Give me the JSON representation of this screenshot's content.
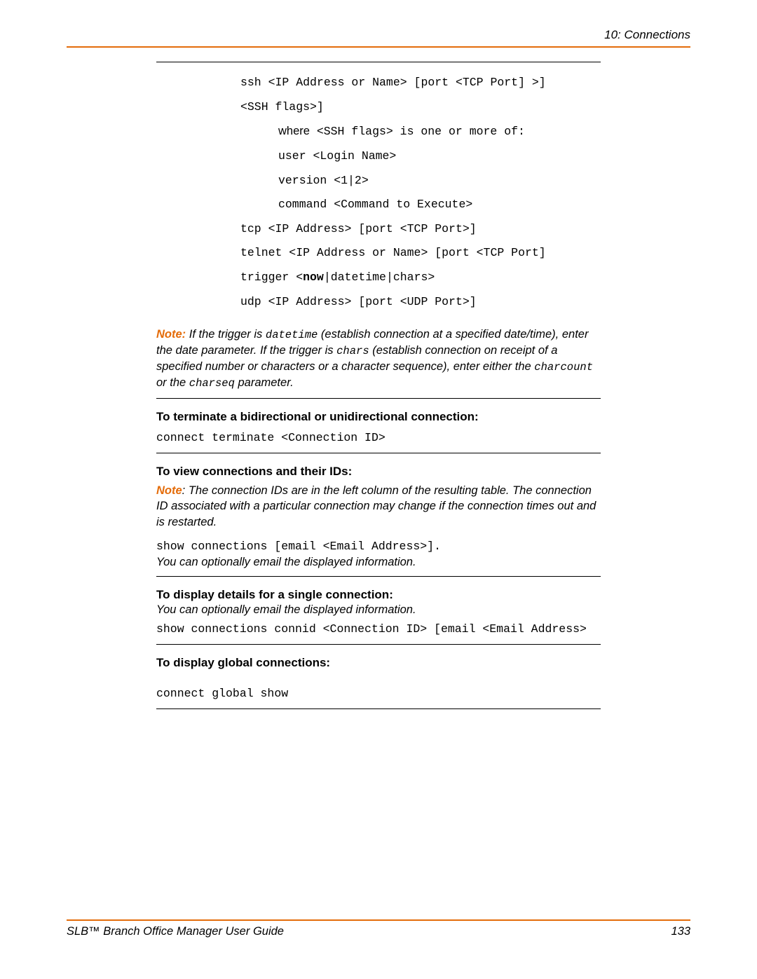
{
  "header": {
    "chapter": "10: Connections"
  },
  "codeblock": {
    "l1": "ssh <IP Address or Name> [port <TCP Port] >]",
    "l2": "<SSH flags>]",
    "l3_where": "where",
    "l3_rest": " <SSH flags> is one or more of:",
    "l4": "user <Login Name>",
    "l5": "version <1|2>",
    "l6": "command <Command to Execute>",
    "l7": "tcp <IP Address> [port <TCP Port>]",
    "l8": "telnet <IP Address or Name> [port <TCP Port]",
    "l9a": "trigger <",
    "l9b": "now",
    "l9c": "|datetime|chars>",
    "l10": "udp <IP Address> [port <UDP Port>]"
  },
  "note1": {
    "label": "Note:",
    "t1": " If the trigger is ",
    "c1": "datetime",
    "t2": " (establish connection at a specified date/time), enter the date parameter. If the trigger is ",
    "c2": "chars",
    "t3": " (establish connection on receipt of a specified number or characters or a character sequence), enter either the ",
    "c3": "charcount",
    "t4": " or the ",
    "c4": "charseq",
    "t5": "  parameter."
  },
  "sec_terminate": {
    "head": "To terminate a bidirectional or unidirectional connection:",
    "cmd": "connect terminate <Connection ID>"
  },
  "sec_view": {
    "head": "To view connections and their IDs:",
    "note_label": "Note",
    "note_body": ": The connection IDs are in the left column of the resulting table. The connection ID associated with a particular connection may change if the connection times out and is restarted.",
    "cmd": "show connections [email <Email Address>].",
    "tail": "You can optionally email the displayed information."
  },
  "sec_single": {
    "head": "To display details for a single connection:",
    "tail": "You can optionally email the displayed information.",
    "cmd": "show connections connid <Connection ID> [email <Email Address>"
  },
  "sec_global": {
    "head": "To display global connections:",
    "cmd": "connect global show"
  },
  "footer": {
    "left": "SLB™ Branch Office Manager User Guide",
    "right": "133"
  }
}
